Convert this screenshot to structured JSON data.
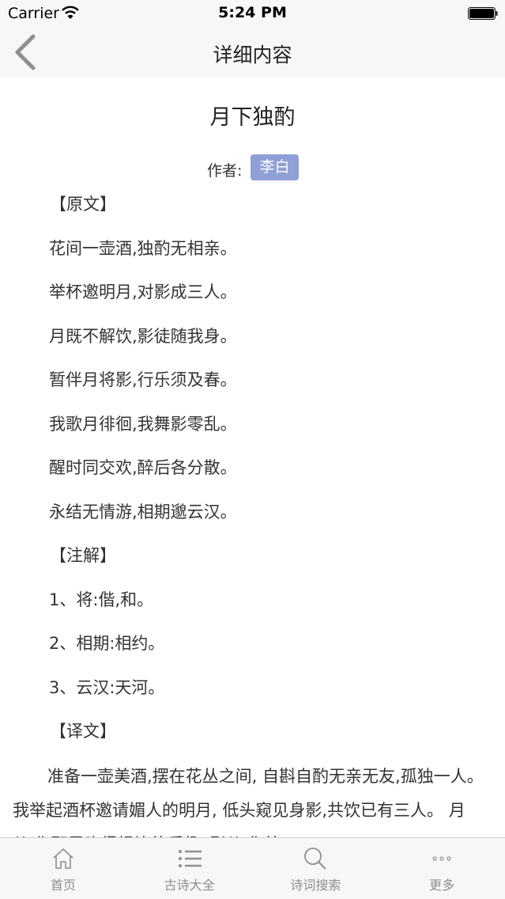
{
  "status_bar": {
    "carrier": "Carrier",
    "time": "5:24 PM"
  },
  "nav": {
    "title": "详细内容",
    "back_icon": "chevron-left-icon"
  },
  "poem": {
    "title": "月下独酌",
    "author_label": "作者:",
    "author": "李白"
  },
  "sections": {
    "original_head": "【原文】",
    "original_lines": [
      "花间一壶酒,独酌无相亲。",
      "举杯邀明月,对影成三人。",
      "月既不解饮,影徒随我身。",
      "暂伴月将影,行乐须及春。",
      "我歌月徘徊,我舞影零乱。",
      "醒时同交欢,醉后各分散。",
      "永结无情游,相期邈云汉。"
    ],
    "notes_head": "【注解】",
    "notes": [
      "1、将:偕,和。",
      "2、相期:相约。",
      "3、云汉:天河。"
    ],
    "translation_head": "【译文】",
    "translation": "准备一壶美酒,摆在花丛之间, 自斟自酌无亲无友,孤独一人。 我举起酒杯邀请媚人的明月, 低头窥见身影,共饮已有三人。 月儿,你那里晓得畅饮的乐趣?影儿,你徒"
  },
  "tab_bar": {
    "tabs": [
      {
        "label": "首页",
        "icon": "home-icon"
      },
      {
        "label": "古诗大全",
        "icon": "list-icon"
      },
      {
        "label": "诗词搜索",
        "icon": "search-icon"
      },
      {
        "label": "更多",
        "icon": "more-icon"
      }
    ]
  },
  "colors": {
    "accent": "#8ea0d6",
    "bar_background": "#f7f7f7",
    "tab_inactive": "#8e8e93"
  }
}
